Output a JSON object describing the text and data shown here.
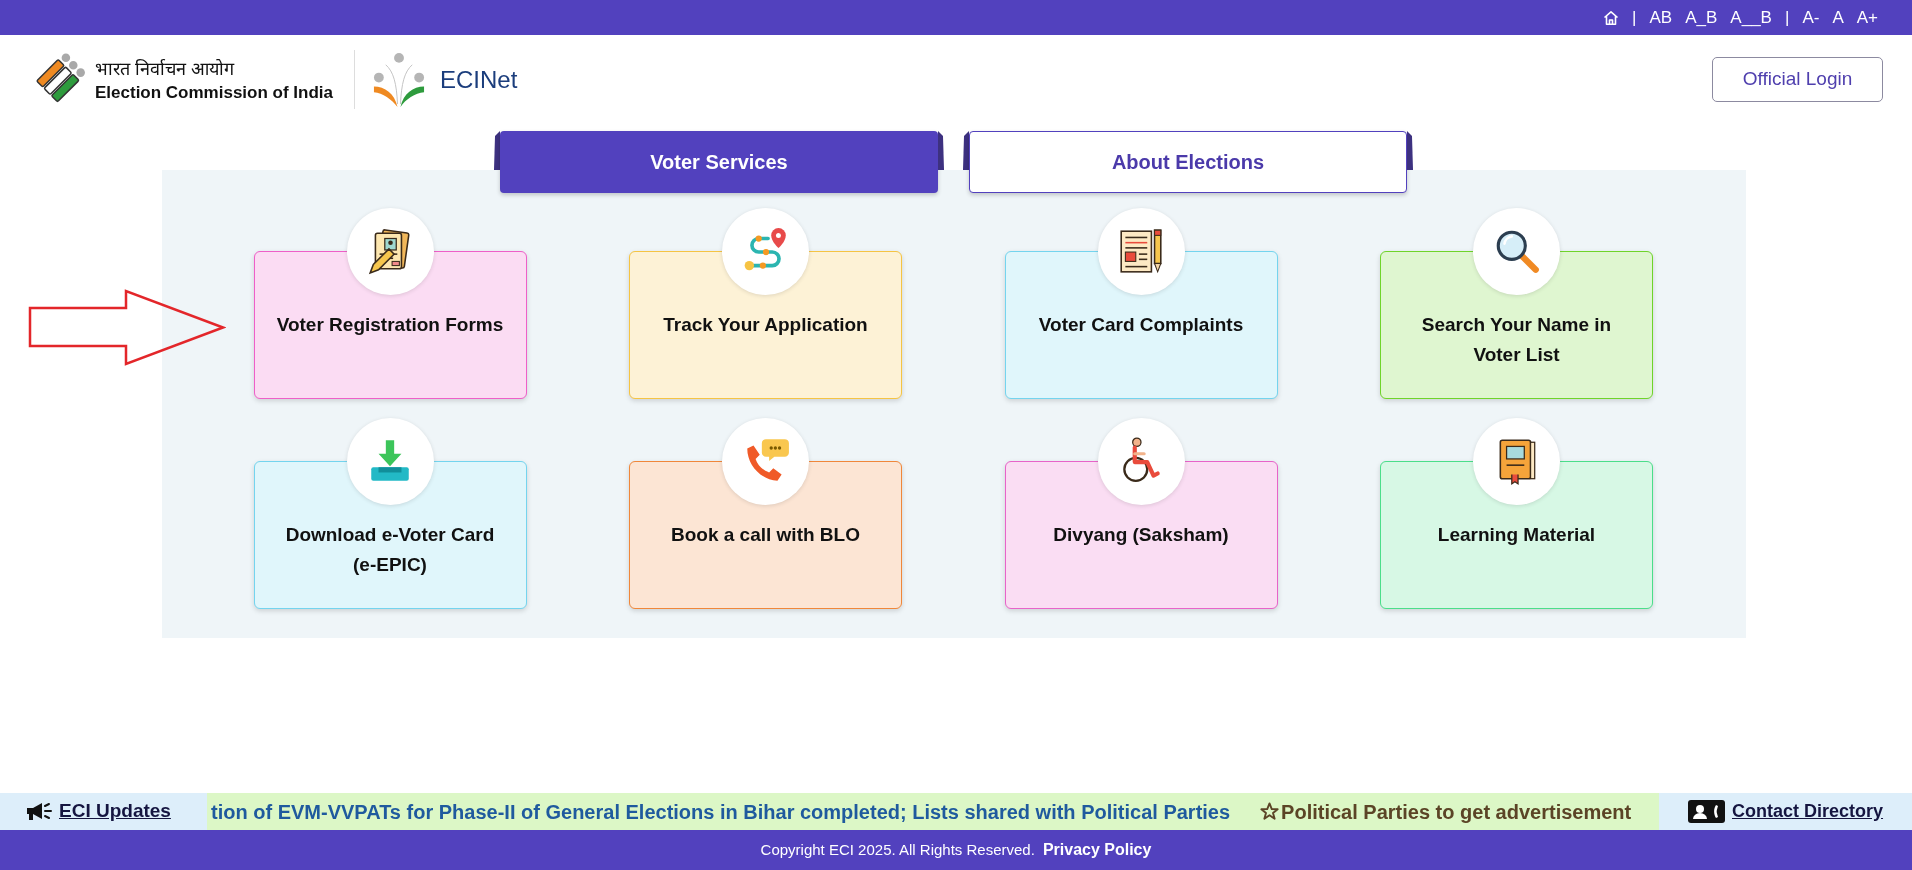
{
  "toolbar": [
    {
      "kind": "home"
    },
    {
      "kind": "separator",
      "text": "|"
    },
    {
      "kind": "spacing",
      "text": "AB"
    },
    {
      "kind": "spacing",
      "text": "A_B"
    },
    {
      "kind": "spacing",
      "text": "A__B"
    },
    {
      "kind": "separator",
      "text": "|"
    },
    {
      "kind": "font_size",
      "text": "A-"
    },
    {
      "kind": "font_size",
      "text": "A"
    },
    {
      "kind": "font_size",
      "text": "A+"
    }
  ],
  "header": {
    "org_name_hindi": "भारत निर्वाचन आयोग",
    "org_name": "Election Commission of India",
    "app_name": "ECINet",
    "login_button": "Official Login"
  },
  "tabs": [
    {
      "label": "Voter Services",
      "selected": true
    },
    {
      "label": "About Elections",
      "selected": false
    }
  ],
  "services": [
    {
      "label": "Voter Registration Forms",
      "color": "#ee5fc8"
    },
    {
      "label": "Track Your Application",
      "color": "#f5c443"
    },
    {
      "label": "Voter Card Complaints",
      "color": "#74d4ee"
    },
    {
      "label": "Search Your Name in Voter List",
      "color": "#6fd42a"
    },
    {
      "label": "Download e-Voter Card (e-EPIC)",
      "color": "#74d4ee"
    },
    {
      "label": "Book a call with BLO",
      "color": "#f0873a"
    },
    {
      "label": "Divyang (Saksham)",
      "color": "#e763c9"
    },
    {
      "label": "Learning Material",
      "color": "#4bde8a"
    }
  ],
  "ticker": {
    "title": "ECI Updates",
    "items": [
      {
        "text": "tion of EVM-VVPATs for Phase-II of General Elections in Bihar completed; Lists shared with Political Parties",
        "color": "#1f5a9e",
        "starred": false
      },
      {
        "text": "Political Parties to get advertisement",
        "color": "#5b4426",
        "starred": true
      }
    ],
    "contact_link": "Contact Directory"
  },
  "footer": {
    "copyright": "Copyright ECI 2025. All Rights Reserved.",
    "privacy_link": "Privacy Policy"
  }
}
